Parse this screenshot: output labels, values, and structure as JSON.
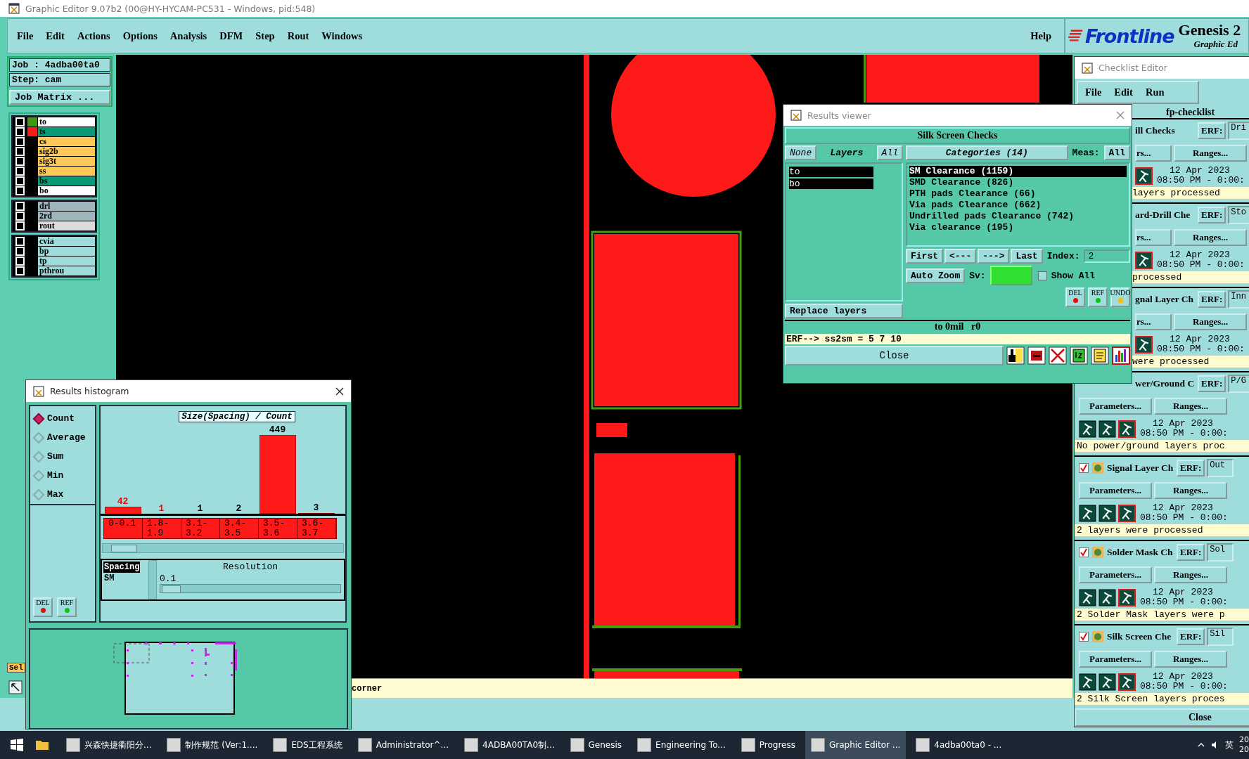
{
  "window": {
    "title": "Graphic Editor 9.07b2 (00@HY-HYCAM-PC531 - Windows, pid:548)"
  },
  "menu": [
    "File",
    "Edit",
    "Actions",
    "Options",
    "Analysis",
    "DFM",
    "Step",
    "Rout",
    "Windows"
  ],
  "help": "Help",
  "brand": {
    "logo": "Frontline",
    "product": "Genesis 2",
    "subtitle": "Graphic Ed"
  },
  "job": {
    "job": "Job : 4adba00ta0",
    "step": "Step: cam",
    "matrix_button": "Job Matrix ..."
  },
  "layer_groups": [
    [
      {
        "name": "to",
        "kind": "silk",
        "color": "#3f9a12",
        "checked": false
      },
      {
        "name": "ts",
        "kind": "mask",
        "color": "#ff1a1a",
        "checked": false
      },
      {
        "name": "cs",
        "kind": "signal",
        "checked": false
      },
      {
        "name": "sig2b",
        "kind": "signal",
        "checked": false
      },
      {
        "name": "sig3t",
        "kind": "signal",
        "checked": false
      },
      {
        "name": "ss",
        "kind": "signal",
        "checked": false
      },
      {
        "name": "bs",
        "kind": "mask",
        "checked": false
      },
      {
        "name": "bo",
        "kind": "silk",
        "checked": false
      }
    ],
    [
      {
        "name": "drl",
        "kind": "drill",
        "checked": false
      },
      {
        "name": "2rd",
        "kind": "drill",
        "checked": false
      },
      {
        "name": "rout",
        "kind": "rout",
        "checked": false
      }
    ],
    [
      {
        "name": "cvia",
        "kind": "document",
        "checked": false
      },
      {
        "name": "bp",
        "kind": "document",
        "checked": false
      },
      {
        "name": "tp",
        "kind": "document",
        "checked": false
      },
      {
        "name": "pthrou",
        "kind": "document",
        "checked": false
      }
    ]
  ],
  "status": {
    "message": "corner",
    "sel": "Sel"
  },
  "histogram": {
    "title": "Results histogram",
    "measures": [
      {
        "label": "Count",
        "selected": true
      },
      {
        "label": "Average",
        "selected": false
      },
      {
        "label": "Sum",
        "selected": false
      },
      {
        "label": "Min",
        "selected": false
      },
      {
        "label": "Max",
        "selected": false
      }
    ],
    "chart_data": {
      "type": "bar",
      "title": "Size(Spacing) / Count",
      "categories": [
        "0-0.1",
        "1.8-1.9",
        "3.1-3.2",
        "3.4-3.5",
        "3.5-3.6",
        "3.6-3.7"
      ],
      "values": [
        42,
        1,
        1,
        2,
        449,
        3
      ],
      "data_labels": true
    },
    "list": [
      {
        "label": "Spacing",
        "selected": true
      },
      {
        "label": "SM",
        "selected": false
      }
    ],
    "resolution_label": "Resolution",
    "resolution_value": "0.1",
    "buttons": [
      "DEL",
      "REF"
    ]
  },
  "viewer": {
    "title": "Results viewer",
    "heading": "Silk Screen Checks",
    "none": "None",
    "layers_label": "Layers",
    "all": "All",
    "layers": [
      {
        "name": "to",
        "selected": true
      },
      {
        "name": "bo",
        "selected": true
      }
    ],
    "categories_button": "Categories (14)",
    "meas_label": "Meas:",
    "meas_value": "All",
    "categories": [
      {
        "label": "SM Clearance (1159)",
        "selected": true
      },
      {
        "label": "SMD Clearance (826)",
        "selected": false
      },
      {
        "label": "PTH pads Clearance (66)",
        "selected": false
      },
      {
        "label": "Via pads Clearance (662)",
        "selected": false
      },
      {
        "label": "Undrilled pads Clearance (742)",
        "selected": false
      },
      {
        "label": "Via clearance (195)",
        "selected": false
      }
    ],
    "nav": [
      "First",
      "<---",
      "--->",
      "Last"
    ],
    "index_label": "Index:",
    "index_value": "2",
    "auto_zoom": "Auto Zoom",
    "sv_label": "Sv:",
    "show_all": {
      "label": "Show All",
      "checked": false
    },
    "tool_buttons": [
      "DEL",
      "REF",
      "UNDO"
    ],
    "replace": "Replace layers",
    "info": "to 0mil   r0",
    "erf_line": "ERF--> ss2sm = 5 7 10",
    "close": "Close"
  },
  "checklist": {
    "title": "Checklist Editor",
    "menu": [
      "File",
      "Edit",
      "Run"
    ],
    "name": "fp-checklist",
    "close": "Close",
    "items": [
      {
        "name": "ill Checks",
        "erf_label": "ERF:",
        "erf": "Dri",
        "params": "rs...",
        "ranges": "Ranges...",
        "date": "12 Apr 2023",
        "time": "08:50 PM - 0:00:",
        "message": "layers processed",
        "header_covered": true,
        "body_covered": true
      },
      {
        "name": "ard-Drill Che",
        "erf_label": "ERF:",
        "erf": "Sto",
        "params": "rs...",
        "ranges": "Ranges...",
        "date": "12 Apr 2023",
        "time": "08:50 PM - 0:00:",
        "message": "processed",
        "header_covered": true,
        "body_covered": true
      },
      {
        "name": "gnal Layer Ch",
        "erf_label": "ERF:",
        "erf": "Inn",
        "params": "rs...",
        "ranges": "Ranges...",
        "date": "12 Apr 2023",
        "time": "08:50 PM - 0:00:",
        "message": "were processed",
        "header_covered": true,
        "body_covered": true
      },
      {
        "name": "wer/Ground C",
        "erf_label": "ERF:",
        "erf": "P/G",
        "params": "Parameters...",
        "ranges": "Ranges...",
        "date": "12 Apr 2023",
        "time": "08:50 PM - 0:00:",
        "message": "No power/ground layers proc",
        "header_covered": true,
        "body_covered": false
      },
      {
        "name": "Signal Layer Ch",
        "erf_label": "ERF:",
        "erf": "Out",
        "params": "Parameters...",
        "ranges": "Ranges...",
        "date": "12 Apr 2023",
        "time": "08:50 PM - 0:00:",
        "message": "2 layers were processed",
        "header_covered": false,
        "body_covered": false,
        "checked": true
      },
      {
        "name": "Solder Mask Ch",
        "erf_label": "ERF:",
        "erf": "Sol",
        "params": "Parameters...",
        "ranges": "Ranges...",
        "date": "12 Apr 2023",
        "time": "08:50 PM - 0:00:",
        "message": "2 Solder Mask layers were p",
        "header_covered": false,
        "body_covered": false,
        "checked": true
      },
      {
        "name": "Silk Screen Che",
        "erf_label": "ERF:",
        "erf": "Sil",
        "params": "Parameters...",
        "ranges": "Ranges...",
        "date": "12 Apr 2023",
        "time": "08:50 PM - 0:00:",
        "message": "2 Silk Screen layers proces",
        "header_covered": false,
        "body_covered": false,
        "checked": true
      }
    ]
  },
  "taskbar": {
    "items": [
      {
        "label": "兴森快捷衢阳分...",
        "selected": false
      },
      {
        "label": "制作规范 (Ver:1....",
        "selected": false
      },
      {
        "label": "EDS工程系统",
        "selected": false
      },
      {
        "label": "Administrator^...",
        "selected": false
      },
      {
        "label": "4ADBA00TA0制...",
        "selected": false
      },
      {
        "label": "Genesis",
        "selected": false
      },
      {
        "label": "Engineering To...",
        "selected": false
      },
      {
        "label": "Progress",
        "selected": false
      },
      {
        "label": "Graphic Editor ...",
        "selected": true
      },
      {
        "label": "4adba00ta0 - ...",
        "selected": false
      }
    ],
    "ime": "英",
    "clock": [
      "20",
      "20"
    ]
  }
}
